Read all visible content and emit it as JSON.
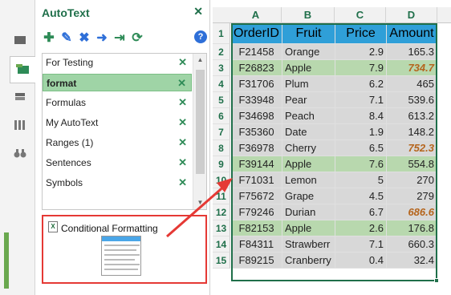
{
  "pane": {
    "title": "AutoText",
    "close_glyph": "✕",
    "help_glyph": "?",
    "toolbar": [
      {
        "icon": "add-icon",
        "glyph": "✚"
      },
      {
        "icon": "edit-icon",
        "glyph": "✎"
      },
      {
        "icon": "delete-icon",
        "glyph": "✖"
      },
      {
        "icon": "insert-icon",
        "glyph": "➜"
      },
      {
        "icon": "export-icon",
        "glyph": "⇥"
      },
      {
        "icon": "refresh-icon",
        "glyph": "⟳"
      }
    ],
    "items": [
      {
        "label": "For Testing",
        "selected": false
      },
      {
        "label": "format",
        "selected": true
      },
      {
        "label": "Formulas",
        "selected": false
      },
      {
        "label": "My AutoText",
        "selected": false
      },
      {
        "label": "Ranges (1)",
        "selected": false
      },
      {
        "label": "Sentences",
        "selected": false
      },
      {
        "label": "Symbols",
        "selected": false
      }
    ],
    "remove_glyph": "✕",
    "preview": {
      "file_badge": "X",
      "name": "Conditional Formatting"
    }
  },
  "sheet": {
    "columns": [
      "A",
      "B",
      "C",
      "D"
    ],
    "rows": [
      {
        "n": "1",
        "cells": [
          "OrderID",
          "Fruit",
          "Price",
          "Amount"
        ],
        "kind": "header"
      },
      {
        "n": "2",
        "cells": [
          "F21458",
          "Orange",
          "2.9",
          "165.3"
        ],
        "kind": "gray",
        "hot": false
      },
      {
        "n": "3",
        "cells": [
          "F26823",
          "Apple",
          "7.9",
          "734.7"
        ],
        "kind": "green",
        "hot": true
      },
      {
        "n": "4",
        "cells": [
          "F31706",
          "Plum",
          "6.2",
          "465"
        ],
        "kind": "gray",
        "hot": false
      },
      {
        "n": "5",
        "cells": [
          "F33948",
          "Pear",
          "7.1",
          "539.6"
        ],
        "kind": "gray",
        "hot": false
      },
      {
        "n": "6",
        "cells": [
          "F34698",
          "Peach",
          "8.4",
          "613.2"
        ],
        "kind": "gray",
        "hot": false
      },
      {
        "n": "7",
        "cells": [
          "F35360",
          "Date",
          "1.9",
          "148.2"
        ],
        "kind": "gray",
        "hot": false
      },
      {
        "n": "8",
        "cells": [
          "F36978",
          "Cherry",
          "6.5",
          "752.3"
        ],
        "kind": "gray",
        "hot": true
      },
      {
        "n": "9",
        "cells": [
          "F39144",
          "Apple",
          "7.6",
          "554.8"
        ],
        "kind": "green",
        "hot": false
      },
      {
        "n": "10",
        "cells": [
          "F71031",
          "Lemon",
          "5",
          "270"
        ],
        "kind": "gray",
        "hot": false
      },
      {
        "n": "11",
        "cells": [
          "F75672",
          "Grape",
          "4.5",
          "279"
        ],
        "kind": "gray",
        "hot": false
      },
      {
        "n": "12",
        "cells": [
          "F79246",
          "Durian",
          "6.7",
          "686.6"
        ],
        "kind": "gray",
        "hot": true
      },
      {
        "n": "13",
        "cells": [
          "F82153",
          "Apple",
          "2.6",
          "176.8"
        ],
        "kind": "green",
        "hot": false
      },
      {
        "n": "14",
        "cells": [
          "F84311",
          "Strawberr",
          "7.1",
          "660.3"
        ],
        "kind": "gray",
        "hot": false
      },
      {
        "n": "15",
        "cells": [
          "F89215",
          "Cranberry",
          "0.4",
          "32.4"
        ],
        "kind": "gray",
        "hot": false
      }
    ]
  },
  "colors": {
    "accent": "#1f6f4a",
    "header_fill": "#2f9fd8",
    "row_gray": "#d8d8d8",
    "row_green": "#b8d8ae",
    "highlight_text": "#b5651d",
    "callout": "#e53935"
  }
}
